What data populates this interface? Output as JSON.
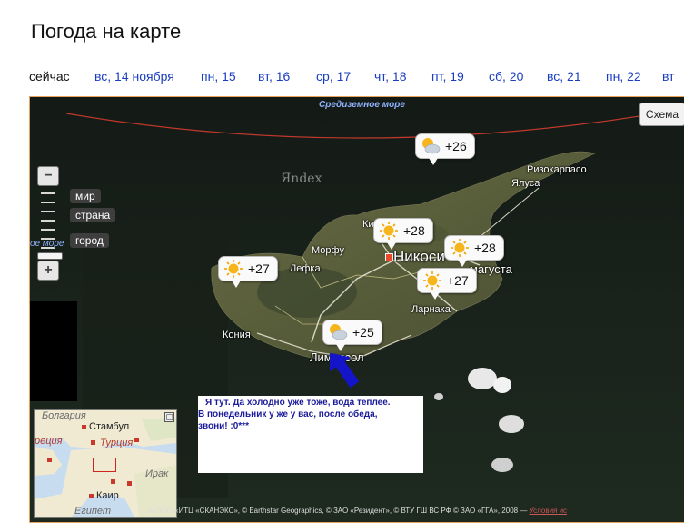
{
  "page": {
    "title": "Погода на карте"
  },
  "dates": {
    "now": "сейчас",
    "days": [
      "вс, 14 ноября",
      "пн, 15",
      "вт, 16",
      "ср, 17",
      "чт, 18",
      "пт, 19",
      "сб, 20",
      "вс, 21",
      "пн, 22",
      "вт"
    ]
  },
  "map": {
    "sea_label": "Средиземное море",
    "watermark": "Яndex",
    "scheme_button": "Схема",
    "zoom": {
      "plus": "+",
      "minus": "−",
      "levels": [
        "мир",
        "страна",
        "город"
      ],
      "sea_hint": "ое море"
    },
    "places": {
      "rizokarpaso": "Ризокарпасо",
      "yalusa": "Ялуса",
      "kirenia": "Ки",
      "morfu": "Морфу",
      "lefka": "Лефка",
      "nicosia": "Никоси",
      "famagusta": "магуста",
      "larnaka": "Ларнака",
      "konia": "Кония",
      "limassol": "Лимассол"
    },
    "weather": [
      {
        "id": "sea",
        "icon": "cloudy-sun-icon",
        "temp": "+26"
      },
      {
        "id": "nicosia",
        "icon": "sun-icon",
        "temp": "+28"
      },
      {
        "id": "famagusta",
        "icon": "sun-icon",
        "temp": "+28"
      },
      {
        "id": "larnaka",
        "icon": "sun-icon",
        "temp": "+27"
      },
      {
        "id": "west",
        "icon": "sun-icon",
        "temp": "+27"
      },
      {
        "id": "limassol",
        "icon": "cloudy-sun-icon",
        "temp": "+25"
      }
    ],
    "minimap": {
      "labels": {
        "bolgaria": "Болгария",
        "istanbul": "Стамбул",
        "greece": "реция",
        "turkey": "Турция",
        "iraq": "Ирак",
        "cairo": "Каир",
        "egypt": "Египет"
      }
    },
    "copyright": "© ООО «ИТЦ «СКАНЭКС», © Earthstar Geographics, © ЗАО «Резидент», © ВТУ ГШ ВС РФ © ЗАО «ГГА», 2008 —",
    "terms": "Условия ис"
  },
  "note": {
    "line1": "Я тут. Да холодно уже тоже, вода теплее.",
    "line2": "В понедельник у же у вас, после обеда,",
    "line3": "звони! :0***"
  },
  "colors": {
    "link": "#1a3dc1",
    "note_text": "#1a1a9a",
    "arrow": "#1414c8",
    "map_border": "#e8a35a"
  }
}
